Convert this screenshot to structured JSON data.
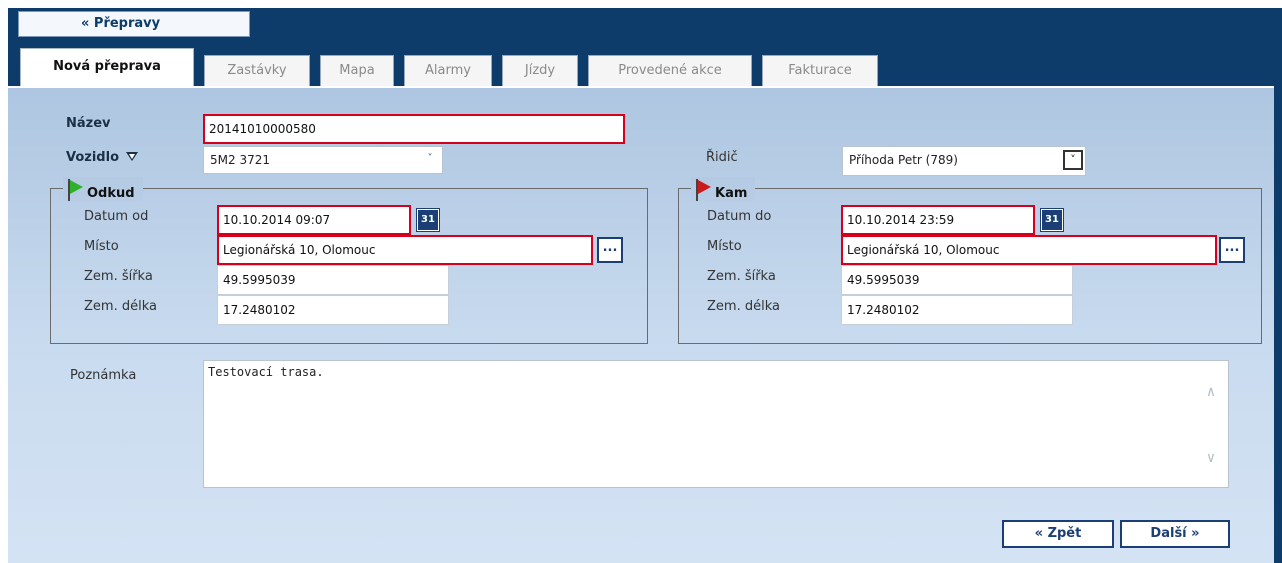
{
  "nav": {
    "back_label": "« Přepravy"
  },
  "tabs": [
    {
      "label": "Nová přeprava",
      "active": true
    },
    {
      "label": "Zastávky"
    },
    {
      "label": "Mapa"
    },
    {
      "label": "Alarmy"
    },
    {
      "label": "Jízdy"
    },
    {
      "label": "Provedené akce"
    },
    {
      "label": "Fakturace"
    }
  ],
  "form": {
    "name_label": "Název",
    "name_value": "20141010000580",
    "vehicle_label": "Vozidlo",
    "vehicle_value": "5M2 3721",
    "driver_label": "Řidič",
    "driver_value": "Příhoda Petr (789)",
    "from": {
      "legend": "Odkud",
      "date_label": "Datum od",
      "date_value": "10.10.2014 09:07",
      "place_label": "Místo",
      "place_value": "Legionářská 10, Olomouc",
      "lat_label": "Zem. šířka",
      "lat_value": "49.5995039",
      "lon_label": "Zem. délka",
      "lon_value": "17.2480102"
    },
    "to": {
      "legend": "Kam",
      "date_label": "Datum do",
      "date_value": "10.10.2014 23:59",
      "place_label": "Místo",
      "place_value": "Legionářská 10, Olomouc",
      "lat_label": "Zem. šířka",
      "lat_value": "49.5995039",
      "lon_label": "Zem. délka",
      "lon_value": "17.2480102"
    },
    "note_label": "Poznámka",
    "note_value": "Testovací trasa.",
    "calendar_glyph": "31",
    "browse_glyph": "..."
  },
  "buttons": {
    "back": "« Zpět",
    "next": "Další »"
  },
  "colors": {
    "frame": "#0d3c6b",
    "required_border": "#d6001c",
    "accent": "#1b3e75"
  }
}
